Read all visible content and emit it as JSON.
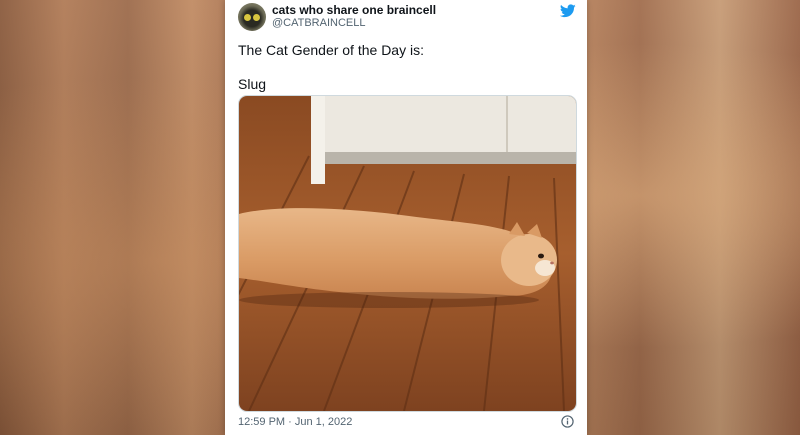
{
  "tweet": {
    "display_name": "cats who share one braincell",
    "handle": "@CATBRAINCELL",
    "text_lines": [
      "The Cat Gender of the Day is:",
      "Slug"
    ],
    "timestamp": "12:59 PM · Jun 1, 2022"
  },
  "icons": {
    "brand": "twitter-bird-icon",
    "info": "info-icon"
  },
  "colors": {
    "brand_blue": "#1d9bf0",
    "text_primary": "#0f1419",
    "text_secondary": "#536471"
  }
}
